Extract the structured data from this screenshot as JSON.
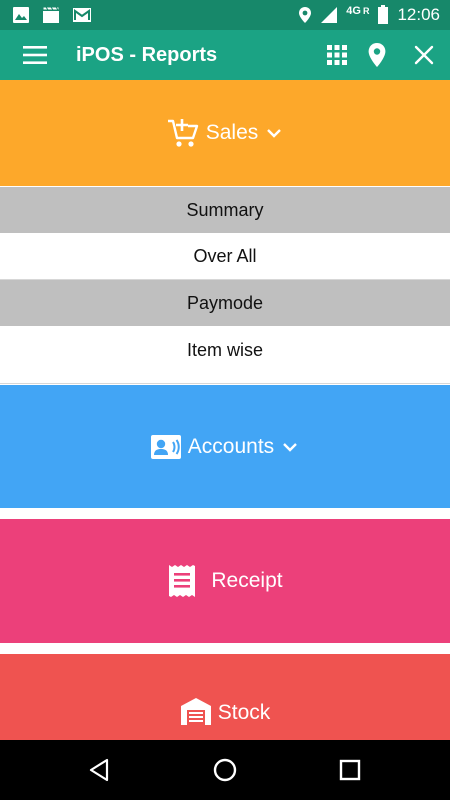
{
  "status_bar": {
    "network_label": "4G",
    "roaming_label": "R",
    "time": "12:06",
    "icons": [
      "image-icon",
      "clapperboard-icon",
      "gmail-icon",
      "location-icon",
      "signal-icon",
      "battery-icon"
    ]
  },
  "app_bar": {
    "title": "iPOS - Reports",
    "actions": [
      "grid-icon",
      "location-pin-icon",
      "close-icon"
    ]
  },
  "sections": {
    "sales": {
      "label": "Sales",
      "color": "#fda82a",
      "icon": "cart-add-icon",
      "expanded": true
    },
    "sales_items": [
      "Summary",
      "Over All",
      "Paymode",
      "Item wise"
    ],
    "accounts": {
      "label": "Accounts",
      "color": "#42a5f5",
      "icon": "contact-card-icon"
    },
    "receipt": {
      "label": "Receipt",
      "color": "#ec407a",
      "icon": "receipt-icon"
    },
    "stock": {
      "label": "Stock",
      "color": "#ef5350",
      "icon": "warehouse-icon"
    }
  },
  "colors": {
    "status_bar": "#17886a",
    "app_bar": "#1ba384",
    "sub_item_grey": "#bfbfbf"
  },
  "nav_bar": [
    "back-icon",
    "home-icon",
    "recents-icon"
  ]
}
